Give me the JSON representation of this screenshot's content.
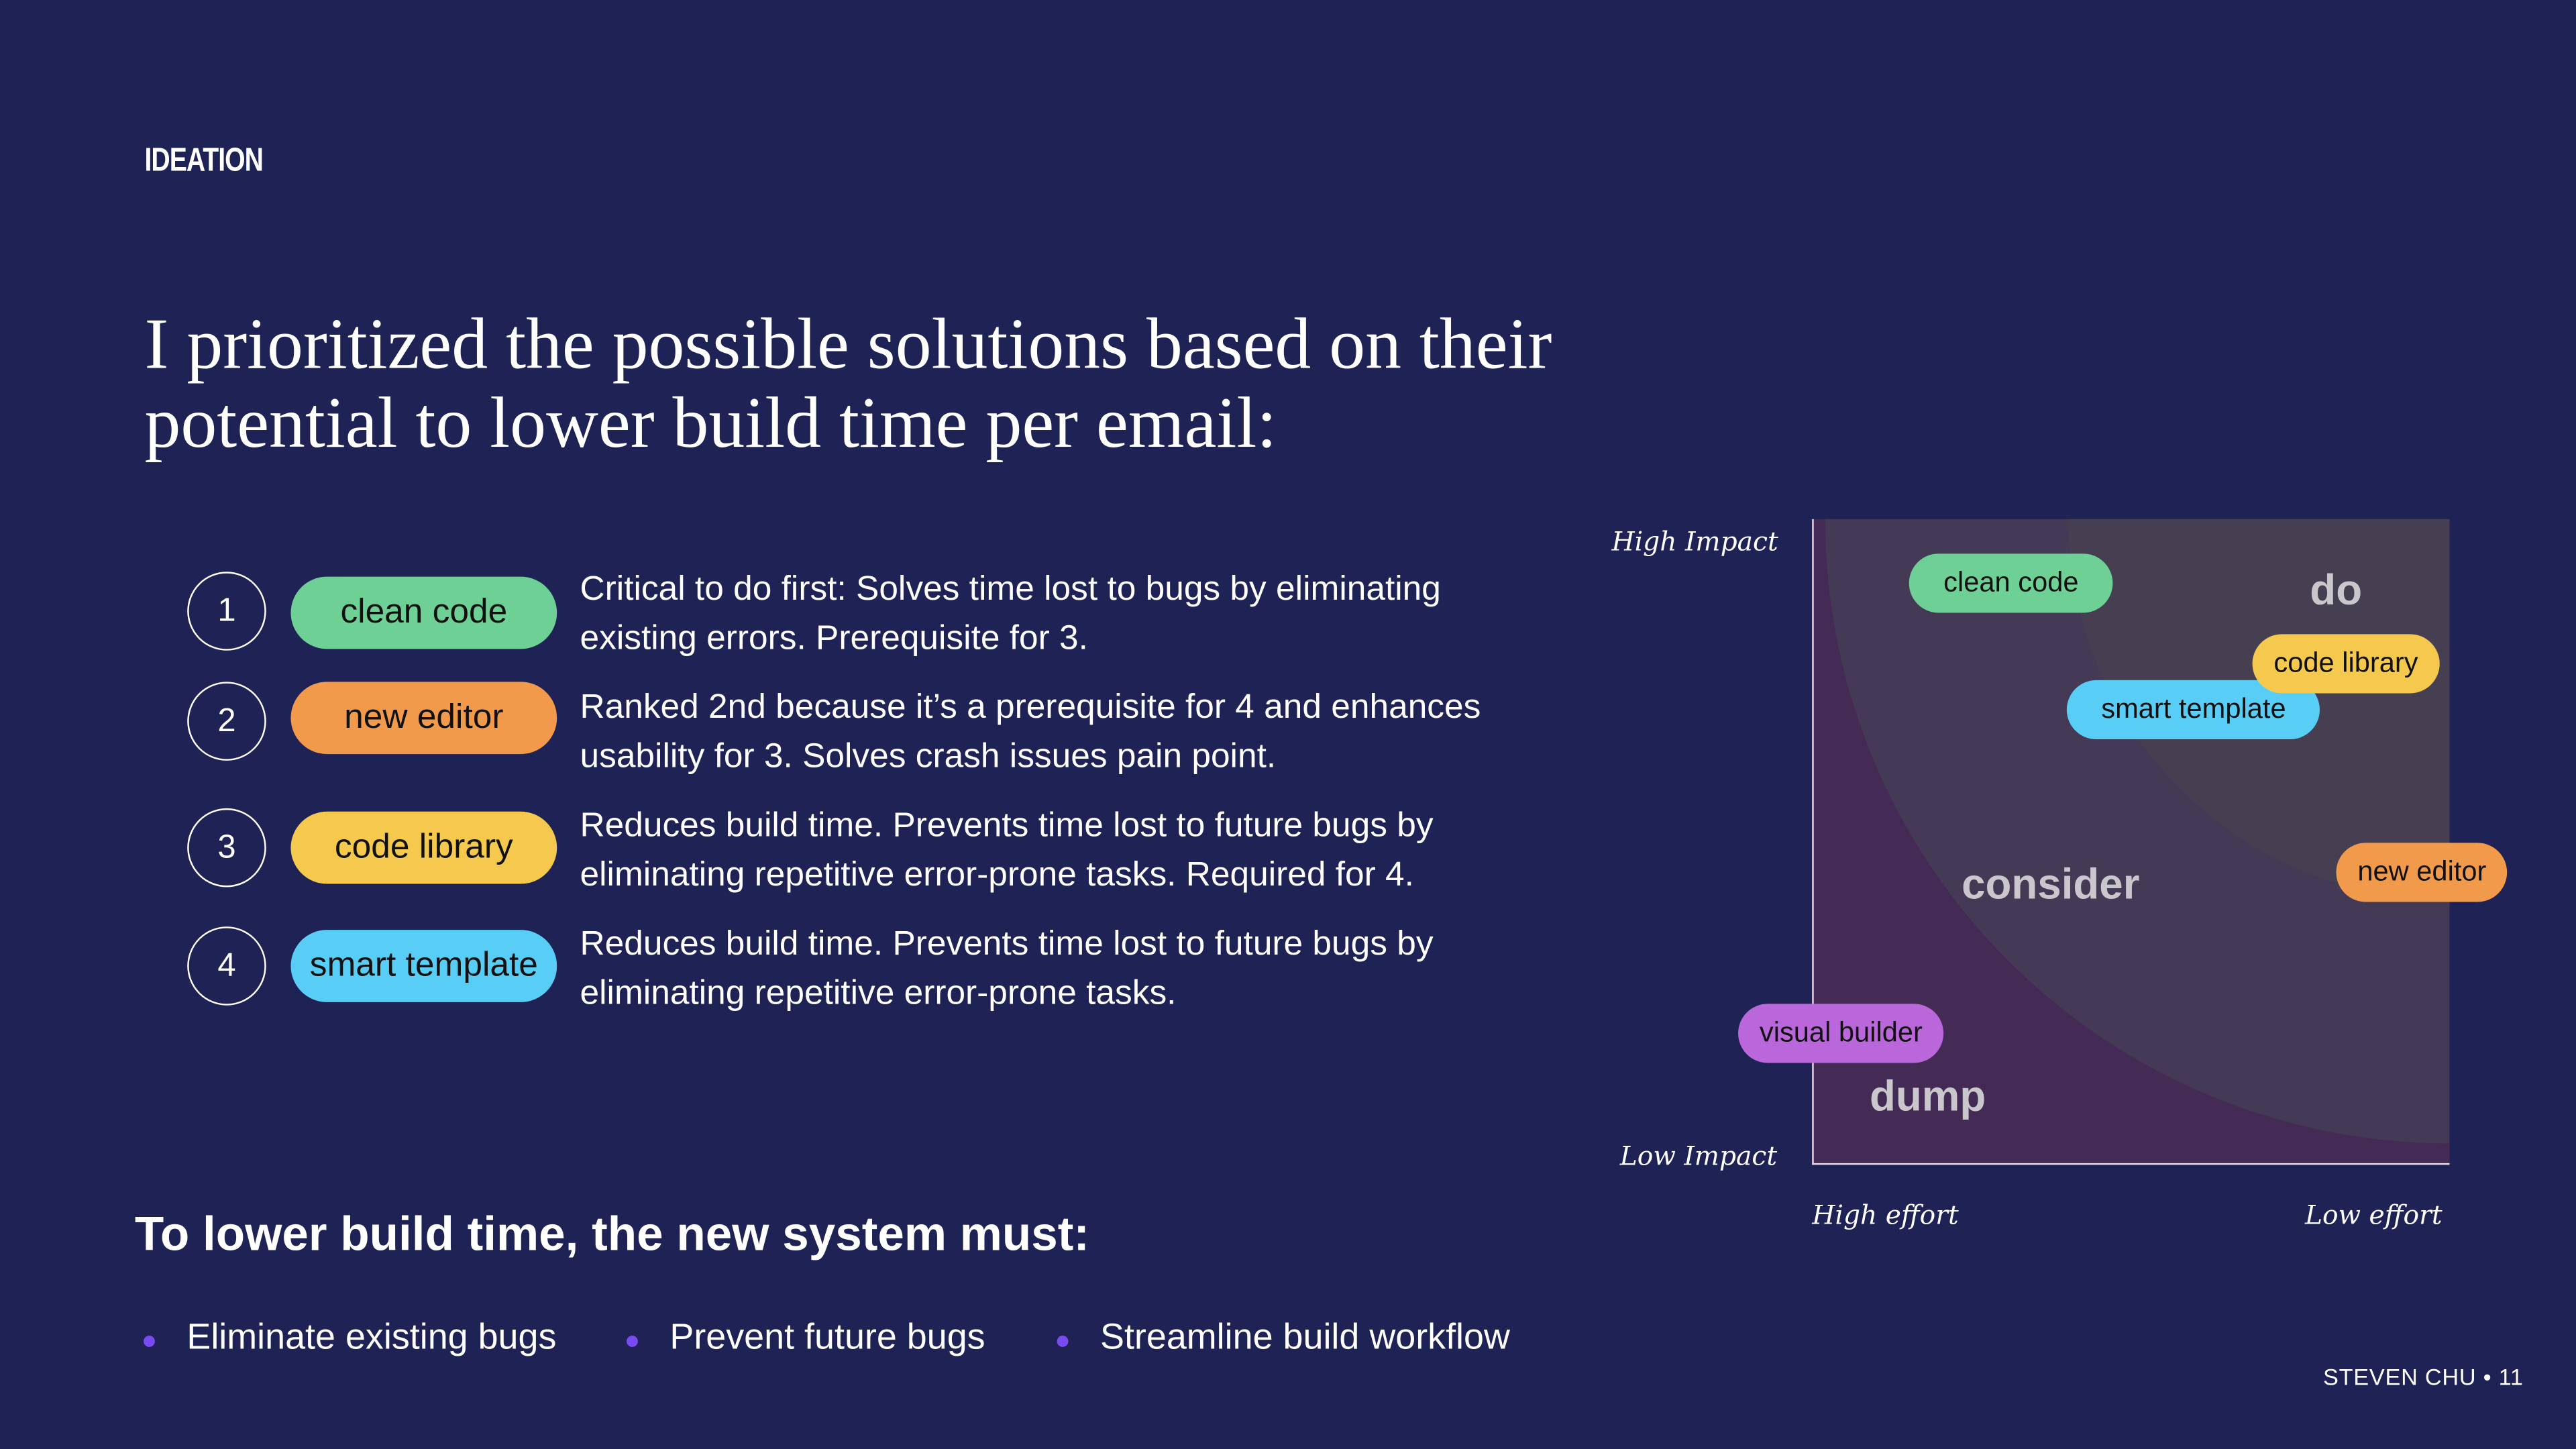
{
  "section_label": "IDEATION",
  "title": "I prioritized the possible solutions based on their potential to lower build time per email:",
  "priorities": [
    {
      "rank": "1",
      "label": "clean code",
      "color": "#6fd096",
      "description": "Critical to do first: Solves time lost to bugs by eliminating existing errors. Prerequisite for 3."
    },
    {
      "rank": "2",
      "label": "new editor",
      "color": "#f29a4b",
      "description": "Ranked 2nd because it’s a prerequisite for 4 and enhances usability for 3. Solves crash issues pain point."
    },
    {
      "rank": "3",
      "label": "code library",
      "color": "#f4c94e",
      "description": "Reduces build time. Prevents time lost to future bugs by eliminating repetitive error-prone tasks. Required for 4."
    },
    {
      "rank": "4",
      "label": "smart template",
      "color": "#58cdf5",
      "description": "Reduces build time. Prevents time lost to future bugs by eliminating repetitive error-prone tasks."
    }
  ],
  "matrix": {
    "y_high": "High Impact",
    "y_low": "Low Impact",
    "x_high": "High effort",
    "x_low": "Low effort",
    "zones": {
      "do": "do",
      "consider": "consider",
      "dump": "dump"
    },
    "zone_colors": {
      "do": "#463f52",
      "consider": "#453a55",
      "dump": "#432b55"
    },
    "tags": [
      {
        "label": "clean code",
        "color": "#6fd096"
      },
      {
        "label": "code library",
        "color": "#f4c94e"
      },
      {
        "label": "smart template",
        "color": "#58cdf5"
      },
      {
        "label": "new editor",
        "color": "#f29a4b"
      },
      {
        "label": "visual builder",
        "color": "#b967da"
      }
    ]
  },
  "requirements": {
    "heading": "To lower build time, the new system must:",
    "items": [
      "Eliminate existing bugs",
      "Prevent future bugs",
      "Streamline build workflow"
    ],
    "bullet_color": "#7a4cf0"
  },
  "footer": "STEVEN CHU • 11"
}
